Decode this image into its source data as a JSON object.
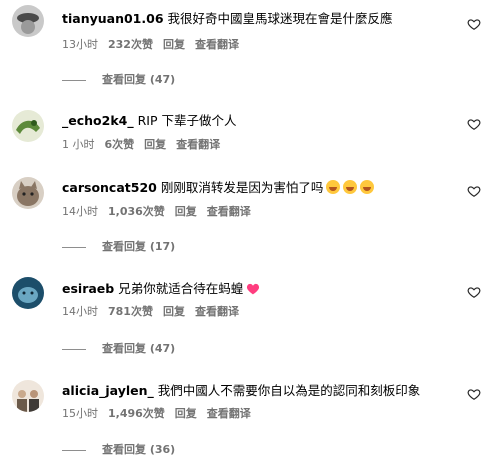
{
  "comments": [
    {
      "username": "tianyuan01.06",
      "text": "我很好奇中國皇馬球迷現在會是什麼反應",
      "time": "13小时",
      "likes": "232次赞",
      "reply": "回复",
      "translate": "查看翻译",
      "view_replies": "查看回复 (47)",
      "avatar": "grey-hat-avatar"
    },
    {
      "username": "_echo2k4_",
      "text": "RIP 下辈子做个人",
      "time": "1 小时",
      "likes": "6次赞",
      "reply": "回复",
      "translate": "查看翻译",
      "avatar": "green-dragon-avatar"
    },
    {
      "username": "carsoncat520",
      "text": "刚刚取消转发是因为害怕了吗",
      "time": "14小时",
      "likes": "1,036次赞",
      "reply": "回复",
      "translate": "查看翻译",
      "view_replies": "查看回复 (17)",
      "avatar": "cat-avatar",
      "emoji": "laughing-emoji"
    },
    {
      "username": "esiraeb",
      "text": "兄弟你就适合待在蚂蝗",
      "time": "14小时",
      "likes": "781次赞",
      "reply": "回复",
      "translate": "查看翻译",
      "view_replies": "查看回复 (47)",
      "avatar": "blue-animal-avatar",
      "emoji": "pink-heart-emoji"
    },
    {
      "username": "alicia_jaylen_",
      "text": "我們中國人不需要你自以為是的認同和刻板印象",
      "time": "15小时",
      "likes": "1,496次赞",
      "reply": "回复",
      "translate": "查看翻译",
      "view_replies": "查看回复 (36)",
      "avatar": "group-photo-avatar"
    }
  ]
}
